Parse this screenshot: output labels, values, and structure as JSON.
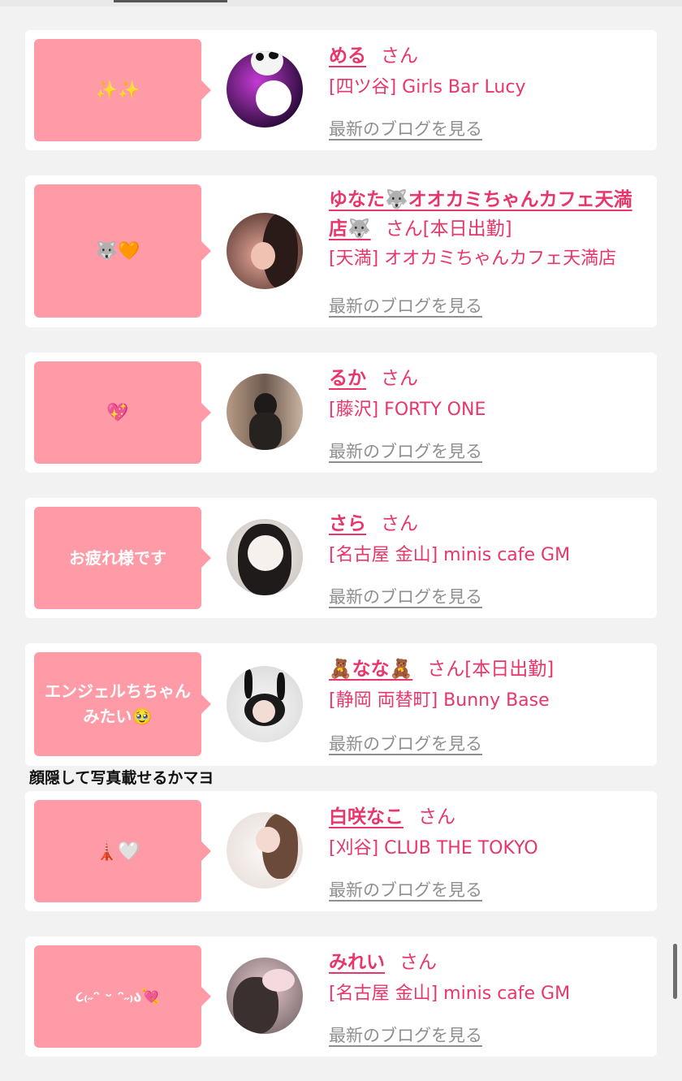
{
  "blog_link_label": "最新のブログを見る",
  "honorific": "さん",
  "caption": "顔隠して写真載せるかマヨ",
  "cards": [
    {
      "message": "✨✨",
      "name": "める",
      "status": "",
      "shop": "[四ツ谷] Girls Bar Lucy"
    },
    {
      "message": "🐺🧡",
      "name": "ゆなた🐺オオカミちゃんカフェ天満店🐺",
      "status": "[本日出勤]",
      "shop": "[天満] オオカミちゃんカフェ天満店"
    },
    {
      "message": "💖",
      "name": "るか",
      "status": "",
      "shop": "[藤沢] FORTY ONE"
    },
    {
      "message": "お疲れ様です",
      "name": "さら",
      "status": "",
      "shop": "[名古屋 金山] minis cafe GM"
    },
    {
      "message": "エンジェルちちゃんみたい🥹",
      "name": "🧸なな🧸",
      "status": "[本日出勤]",
      "shop": "[静岡 両替町] Bunny Base"
    },
    {
      "message": "🗼🤍",
      "name": "白咲なこ",
      "status": "",
      "shop": "[刈谷] CLUB THE TOKYO"
    },
    {
      "message": "૮₍˶ᵔ ᵕ ᵔ˶₎ა💘",
      "name": "みれい",
      "status": "",
      "shop": "[名古屋 金山] minis cafe GM"
    }
  ]
}
